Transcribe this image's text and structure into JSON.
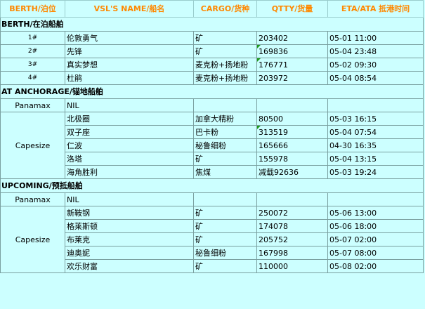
{
  "headers": [
    "BERTH/泊位",
    "VSL'S NAME/船名",
    "CARGO/货种",
    "QTTY/货量",
    "ETA/ATA 抵港时间"
  ],
  "sections": {
    "berth": "BERTH/在泊船舶",
    "anchorage": "AT ANCHORAGE/锚地船舶",
    "upcoming": "UPCOMING/预抵船舶"
  },
  "berth_rows": [
    {
      "berth": "1#",
      "name": "伦敦勇气",
      "cargo": "矿",
      "qtty": "203402",
      "eta": "05-01 11:00"
    },
    {
      "berth": "2#",
      "name": "先锋",
      "cargo": "矿",
      "qtty": "169836",
      "eta": "05-04 23:48"
    },
    {
      "berth": "3#",
      "name": "真实梦想",
      "cargo": "麦克粉+扬地粉",
      "qtty": "176771",
      "eta": "05-02 09:30"
    },
    {
      "berth": "4#",
      "name": "杜鹃",
      "cargo": "麦克粉+扬地粉",
      "qtty": "203972",
      "eta": "05-04 08:54"
    }
  ],
  "anchorage": {
    "panamax_label": "Panamax",
    "panamax_value": "NIL",
    "capesize_label": "Capesize",
    "capesize_rows": [
      {
        "name": "北极圈",
        "cargo": "加拿大精粉",
        "qtty": "80500",
        "eta": "05-03 16:15"
      },
      {
        "name": "双子座",
        "cargo": "巴卡粉",
        "qtty": "313519",
        "eta": "05-04 07:54"
      },
      {
        "name": "仁波",
        "cargo": "秘鲁细粉",
        "qtty": "165666",
        "eta": "04-30 16:35"
      },
      {
        "name": "洛塔",
        "cargo": "矿",
        "qtty": "155978",
        "eta": "05-04 13:15"
      },
      {
        "name": "海角胜利",
        "cargo": "焦煤",
        "qtty": "减载92636",
        "eta": "05-03 19:24"
      }
    ]
  },
  "upcoming": {
    "panamax_label": "Panamax",
    "panamax_value": "NIL",
    "capesize_label": "Capesize",
    "capesize_rows": [
      {
        "name": "新鞍钢",
        "cargo": "矿",
        "qtty": "250072",
        "eta": "05-06 13:00"
      },
      {
        "name": "格莱斯顿",
        "cargo": "矿",
        "qtty": "174078",
        "eta": "05-06 18:00"
      },
      {
        "name": "布莱克",
        "cargo": "矿",
        "qtty": "205752",
        "eta": "05-07 02:00"
      },
      {
        "name": "迪奥妮",
        "cargo": "秘鲁细粉",
        "qtty": "167998",
        "eta": "05-07 08:00"
      },
      {
        "name": "欢乐财富",
        "cargo": "矿",
        "qtty": "110000",
        "eta": "05-08 02:00"
      }
    ]
  }
}
